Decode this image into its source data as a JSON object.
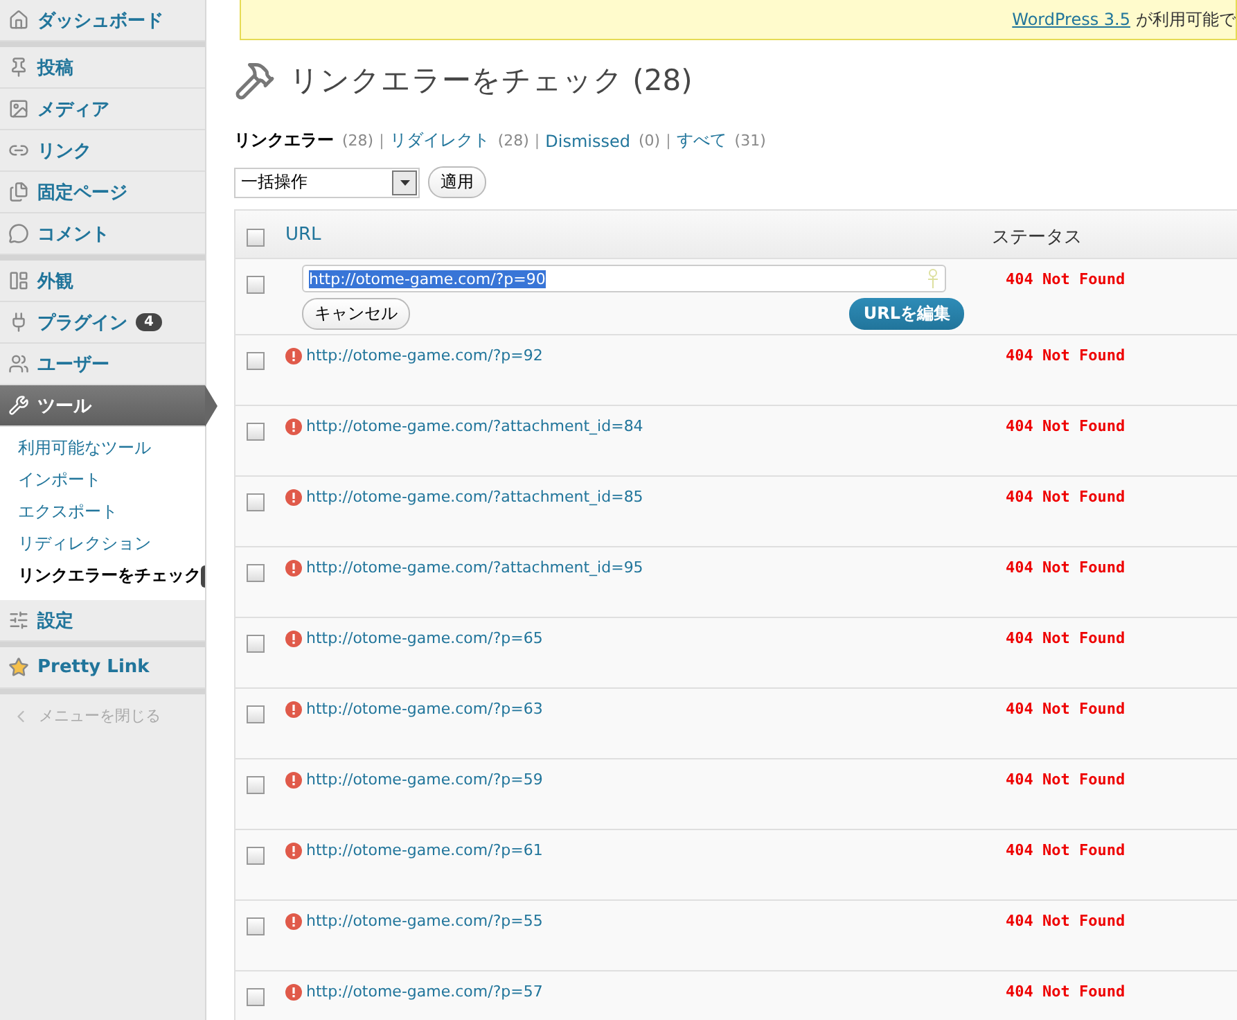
{
  "sidebar": {
    "groups": [
      {
        "items": [
          {
            "label": "ダッシュボード",
            "selected": false
          }
        ]
      },
      {
        "items": [
          {
            "label": "投稿",
            "selected": false
          },
          {
            "label": "メディア",
            "selected": false
          },
          {
            "label": "リンク",
            "selected": false
          },
          {
            "label": "固定ページ",
            "selected": false
          },
          {
            "label": "コメント",
            "selected": false
          }
        ]
      },
      {
        "items": [
          {
            "label": "外観",
            "selected": false
          },
          {
            "label": "プラグイン",
            "badge": "4",
            "selected": false
          },
          {
            "label": "ユーザー",
            "selected": false
          },
          {
            "label": "ツール",
            "selected": true,
            "children": [
              {
                "label": "利用可能なツール",
                "selected": false
              },
              {
                "label": "インポート",
                "selected": false
              },
              {
                "label": "エクスポート",
                "selected": false
              },
              {
                "label": "リディレクション",
                "selected": false
              },
              {
                "label": "リンクエラーをチェック",
                "selected": true
              }
            ]
          },
          {
            "label": "設定",
            "selected": false
          }
        ]
      },
      {
        "items": [
          {
            "label": "Pretty Link",
            "selected": false
          }
        ]
      }
    ],
    "collapse": "メニューを閉じる"
  },
  "notice": {
    "link": "WordPress 3.5",
    "text": "が利用可能で"
  },
  "title": "リンクエラーをチェック (28)",
  "filters": [
    {
      "label": "リンクエラー",
      "count": "(28)",
      "separator": "|",
      "selected": true
    },
    {
      "label": "リダイレクト",
      "count": "(28)",
      "separator": "|",
      "selected": false
    },
    {
      "label": "Dismissed",
      "count": "(0)",
      "separator": "|",
      "selected": false
    },
    {
      "label": "すべて",
      "count": "(31)",
      "selected": false
    }
  ],
  "bulk": {
    "value": "一括操作",
    "apply": "適用"
  },
  "table": {
    "columns": [
      "URL",
      "ステータス"
    ],
    "header_checked": false,
    "rows": [
      {
        "kind": "editing",
        "url": "http://otome-game.com/?p=90",
        "cancel": "キャンセル",
        "save": "URLを編集",
        "status": "404 Not Found",
        "checked": false
      },
      {
        "kind": "link",
        "url": "http://otome-game.com/?p=92",
        "status": "404 Not Found",
        "checked": false
      },
      {
        "kind": "link",
        "url": "http://otome-game.com/?attachment_id=84",
        "status": "404 Not Found",
        "checked": false
      },
      {
        "kind": "link",
        "url": "http://otome-game.com/?attachment_id=85",
        "status": "404 Not Found",
        "checked": false
      },
      {
        "kind": "link",
        "url": "http://otome-game.com/?attachment_id=95",
        "status": "404 Not Found",
        "checked": false
      },
      {
        "kind": "link",
        "url": "http://otome-game.com/?p=65",
        "status": "404 Not Found",
        "checked": false
      },
      {
        "kind": "link",
        "url": "http://otome-game.com/?p=63",
        "status": "404 Not Found",
        "checked": false
      },
      {
        "kind": "link",
        "url": "http://otome-game.com/?p=59",
        "status": "404 Not Found",
        "checked": false
      },
      {
        "kind": "link",
        "url": "http://otome-game.com/?p=61",
        "status": "404 Not Found",
        "checked": false
      },
      {
        "kind": "link",
        "url": "http://otome-game.com/?p=55",
        "status": "404 Not Found",
        "checked": false
      },
      {
        "kind": "link",
        "url": "http://otome-game.com/?p=57",
        "status": "404 Not Found",
        "checked": false
      }
    ]
  }
}
